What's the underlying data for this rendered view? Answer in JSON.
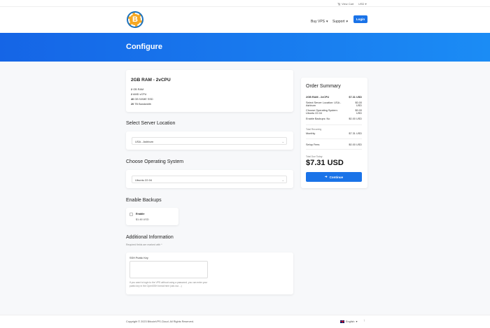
{
  "topbar": {
    "cart_label": "View Cart",
    "currency": "USD",
    "cart_icon": "cart-icon"
  },
  "header": {
    "logo_letter": "B",
    "nav": [
      {
        "label": "Buy VPS"
      },
      {
        "label": "Support"
      }
    ],
    "login_label": "Login"
  },
  "hero": {
    "title": "Configure"
  },
  "product": {
    "name": "2GB RAM - 2vCPU",
    "features": [
      {
        "qty": "2",
        "label": "GB RAM"
      },
      {
        "qty": "2",
        "label": "AMD vCPU"
      },
      {
        "qty": "40",
        "label": "GB NVME SSD"
      },
      {
        "qty": "20",
        "label": "TB Bandwidth"
      }
    ]
  },
  "location": {
    "title": "Select Server Location",
    "value": "USA - Ashburn"
  },
  "os": {
    "title": "Choose Operating System",
    "value": "Ubuntu 22.04"
  },
  "backups": {
    "title": "Enable Backups",
    "option_label": "Enable",
    "price": "$1.46 USD"
  },
  "additional": {
    "title": "Additional Information",
    "required_note": "Required fields are marked with *",
    "ssh_label": "SSH Public Key",
    "ssh_help": "If you want to login to the VPS without using a password, you can enter your public key in the OpenSSH format here (ssh-rsa ...)"
  },
  "summary": {
    "title": "Order Summary",
    "lines": [
      {
        "label": "2GB RAM - 2vCPU",
        "value": "$7.31 USD"
      },
      {
        "label": "Select Server Location: USA - Ashburn",
        "value": "$0.00 USD"
      },
      {
        "label": "Choose Operating System: Ubuntu 22.04",
        "value": "$0.00 USD"
      },
      {
        "label": "Enable Backups: No",
        "value": "$0.00 USD"
      }
    ],
    "recurring_label": "Total Recurring",
    "monthly_label": "Monthly",
    "monthly_value": "$7.31 USD",
    "setup_label": "Setup Fees",
    "setup_value": "$0.00 USD",
    "total_due_label": "Total Due Today",
    "total": "$7.31 USD",
    "continue_label": "Continue"
  },
  "footer": {
    "copyright": "Copyright © 2023 BitcoinVPS.Cloud. All Rights Reserved.",
    "language": "English"
  }
}
